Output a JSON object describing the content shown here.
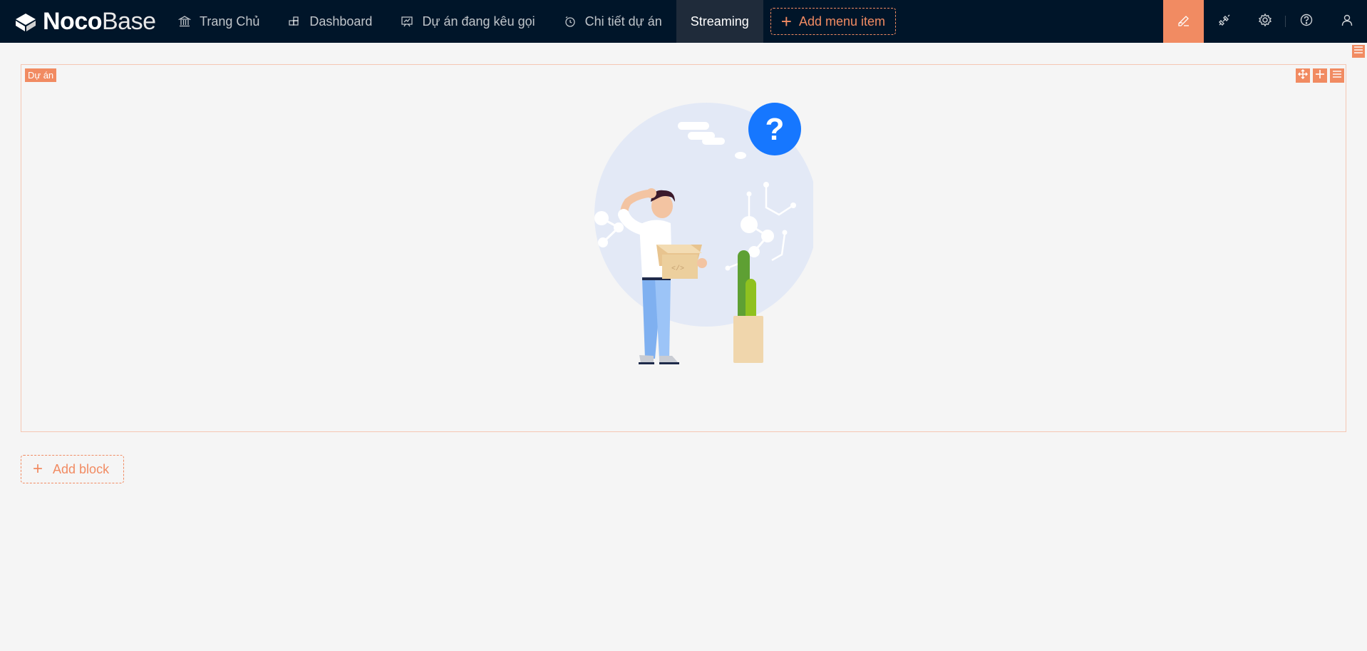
{
  "header": {
    "logo": {
      "bold": "Noco",
      "light": "Base"
    },
    "menu": [
      {
        "label": "Trang Chủ",
        "icon": "bank-icon"
      },
      {
        "label": "Dashboard",
        "icon": "blocks-icon"
      },
      {
        "label": "Dự án đang kêu gọi",
        "icon": "presentation-chart-icon"
      },
      {
        "label": "Chi tiết dự án",
        "icon": "clock-icon"
      },
      {
        "label": "Streaming",
        "icon": "",
        "active": true
      }
    ],
    "add_menu_label": "Add menu item",
    "tools": [
      "ui-editor-icon",
      "plugin-icon",
      "settings-icon",
      "help-icon",
      "user-icon"
    ]
  },
  "block": {
    "title": "Dự án",
    "tools": [
      "drag-icon",
      "add-icon",
      "menu-icon"
    ],
    "empty_illustration": "question-person-with-box"
  },
  "add_block_label": "Add block",
  "colors": {
    "header_bg": "#001529",
    "accent": "#f18b62",
    "page_bg": "#f5f5f5",
    "question_blue": "#1677ff"
  }
}
